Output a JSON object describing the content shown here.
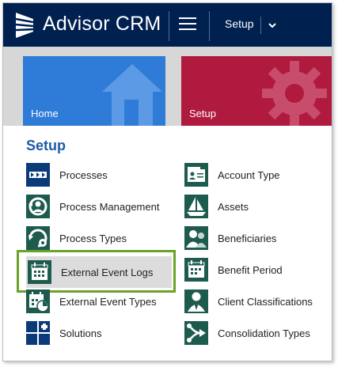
{
  "header": {
    "app_title": "Advisor CRM",
    "nav_setup_label": "Setup"
  },
  "tiles": [
    {
      "label": "Home",
      "color": "#2e7bd8"
    },
    {
      "label": "Setup",
      "color": "#b01a3f"
    }
  ],
  "section_title": "Setup",
  "left_items": [
    {
      "label": "Processes",
      "icon": "processes-icon"
    },
    {
      "label": "Process Management",
      "icon": "process-management-icon"
    },
    {
      "label": "Process Types",
      "icon": "process-types-icon"
    },
    {
      "label": "External Event Logs",
      "icon": "external-event-logs-icon",
      "selected": true
    },
    {
      "label": "External Event Types",
      "icon": "external-event-types-icon"
    },
    {
      "label": "Solutions",
      "icon": "solutions-icon"
    }
  ],
  "right_items": [
    {
      "label": "Account Type",
      "icon": "account-type-icon"
    },
    {
      "label": "Assets",
      "icon": "assets-icon"
    },
    {
      "label": "Beneficiaries",
      "icon": "beneficiaries-icon"
    },
    {
      "label": "Benefit Period",
      "icon": "benefit-period-icon"
    },
    {
      "label": "Client Classifications",
      "icon": "client-classifications-icon"
    },
    {
      "label": "Consolidation Types",
      "icon": "consolidation-types-icon"
    }
  ],
  "colors": {
    "header_bg": "#002050",
    "icon_blue": "#0b3a7a",
    "icon_teal": "#1e5b4f",
    "section_title": "#1d5ba8",
    "highlight_border": "#6ba228"
  }
}
